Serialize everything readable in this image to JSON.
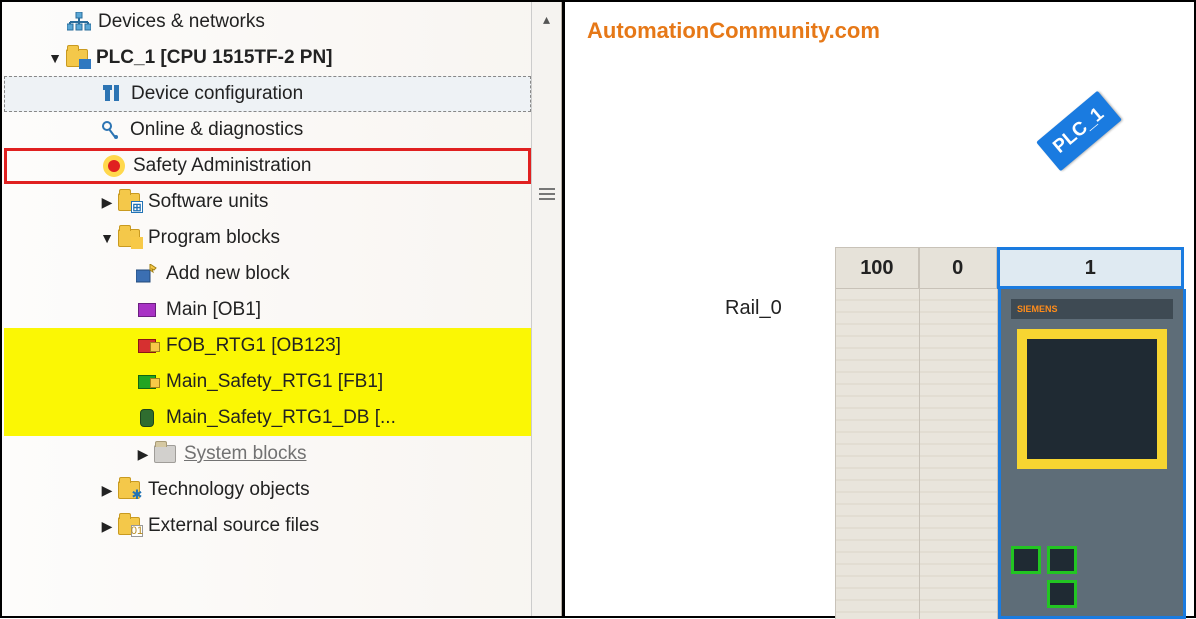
{
  "watermark": "AutomationCommunity.com",
  "tree": {
    "devices_networks": "Devices & networks",
    "plc": "PLC_1 [CPU 1515TF-2 PN]",
    "device_config": "Device configuration",
    "online_diag": "Online & diagnostics",
    "safety_admin": "Safety Administration",
    "software_units": "Software units",
    "program_blocks": "Program blocks",
    "add_block": "Add new block",
    "main_ob": "Main [OB1]",
    "fob_rtg1": "FOB_RTG1 [OB123]",
    "main_safety_fb": "Main_Safety_RTG1 [FB1]",
    "main_safety_db": "Main_Safety_RTG1_DB [...",
    "system_blocks": "System blocks",
    "tech_objects": "Technology objects",
    "ext_sources": "External source files"
  },
  "device": {
    "flag": "PLC_1",
    "rail": "Rail_0",
    "slots": {
      "a": "100",
      "b": "0",
      "c": "1"
    }
  }
}
